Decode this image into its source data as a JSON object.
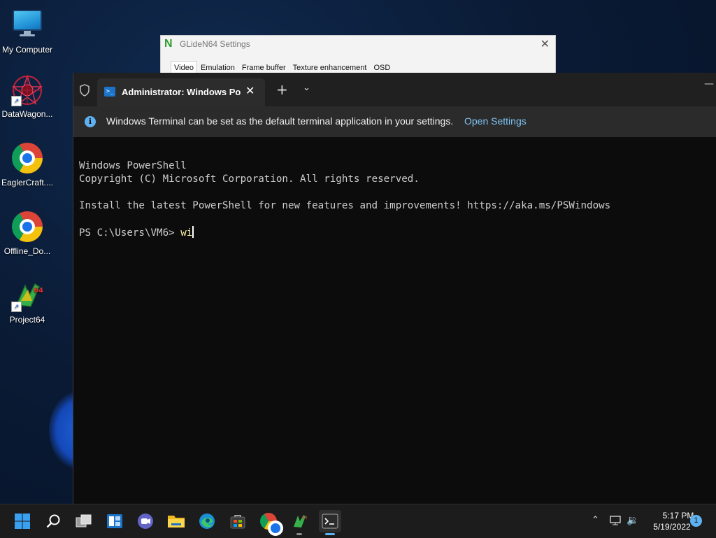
{
  "desktop": {
    "icons": [
      {
        "label": "My Computer",
        "icon": "monitor-icon"
      },
      {
        "label": "DataWagon...",
        "icon": "datawagon-icon"
      },
      {
        "label": "EaglerCraft....",
        "icon": "chrome-icon"
      },
      {
        "label": "Offline_Do...",
        "icon": "chrome-icon"
      },
      {
        "label": "Project64",
        "icon": "project64-icon"
      }
    ]
  },
  "glide_window": {
    "title": "GLideN64 Settings",
    "logo": "N",
    "tabs": [
      "Video",
      "Emulation",
      "Frame buffer",
      "Texture enhancement",
      "OSD"
    ],
    "active_tab": "Video"
  },
  "terminal": {
    "tab_title": "Administrator: Windows PowerShell",
    "new_tab_symbol": "+",
    "infobar": {
      "message": "Windows Terminal can be set as the default terminal application in your settings.",
      "link": "Open Settings"
    },
    "lines": [
      "Windows PowerShell",
      "Copyright (C) Microsoft Corporation. All rights reserved.",
      "",
      "Install the latest PowerShell for new features and improvements! https://aka.ms/PSWindows",
      ""
    ],
    "prompt": "PS C:\\Users\\VM6> ",
    "input": "wi"
  },
  "taskbar": {
    "items": [
      "start",
      "search",
      "task-view",
      "widgets",
      "teams-chat",
      "file-explorer",
      "edge",
      "store",
      "chrome",
      "project64",
      "terminal"
    ],
    "active": "terminal",
    "clock_time": "5:17 PM",
    "clock_date": "5/19/2022",
    "notification_count": "1"
  },
  "colors": {
    "console_bg": "#0c0c0c",
    "console_text": "#cccccc",
    "command_text": "#f9f1a5",
    "link": "#7fc3f5",
    "accent": "#5fb2f2"
  }
}
